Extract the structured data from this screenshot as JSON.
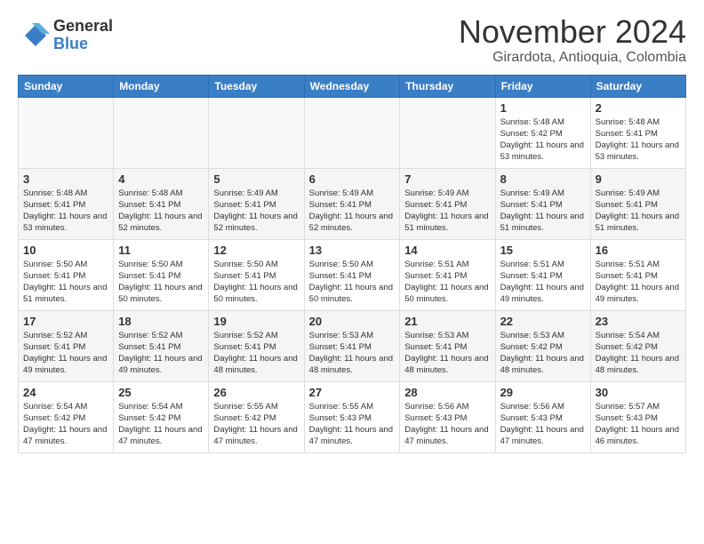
{
  "header": {
    "logo_general": "General",
    "logo_blue": "Blue",
    "month_title": "November 2024",
    "location": "Girardota, Antioquia, Colombia"
  },
  "days_of_week": [
    "Sunday",
    "Monday",
    "Tuesday",
    "Wednesday",
    "Thursday",
    "Friday",
    "Saturday"
  ],
  "weeks": [
    [
      {
        "day": "",
        "sunrise": "",
        "sunset": "",
        "daylight": ""
      },
      {
        "day": "",
        "sunrise": "",
        "sunset": "",
        "daylight": ""
      },
      {
        "day": "",
        "sunrise": "",
        "sunset": "",
        "daylight": ""
      },
      {
        "day": "",
        "sunrise": "",
        "sunset": "",
        "daylight": ""
      },
      {
        "day": "",
        "sunrise": "",
        "sunset": "",
        "daylight": ""
      },
      {
        "day": "1",
        "sunrise": "Sunrise: 5:48 AM",
        "sunset": "Sunset: 5:42 PM",
        "daylight": "Daylight: 11 hours and 53 minutes."
      },
      {
        "day": "2",
        "sunrise": "Sunrise: 5:48 AM",
        "sunset": "Sunset: 5:41 PM",
        "daylight": "Daylight: 11 hours and 53 minutes."
      }
    ],
    [
      {
        "day": "3",
        "sunrise": "Sunrise: 5:48 AM",
        "sunset": "Sunset: 5:41 PM",
        "daylight": "Daylight: 11 hours and 53 minutes."
      },
      {
        "day": "4",
        "sunrise": "Sunrise: 5:48 AM",
        "sunset": "Sunset: 5:41 PM",
        "daylight": "Daylight: 11 hours and 52 minutes."
      },
      {
        "day": "5",
        "sunrise": "Sunrise: 5:49 AM",
        "sunset": "Sunset: 5:41 PM",
        "daylight": "Daylight: 11 hours and 52 minutes."
      },
      {
        "day": "6",
        "sunrise": "Sunrise: 5:49 AM",
        "sunset": "Sunset: 5:41 PM",
        "daylight": "Daylight: 11 hours and 52 minutes."
      },
      {
        "day": "7",
        "sunrise": "Sunrise: 5:49 AM",
        "sunset": "Sunset: 5:41 PM",
        "daylight": "Daylight: 11 hours and 51 minutes."
      },
      {
        "day": "8",
        "sunrise": "Sunrise: 5:49 AM",
        "sunset": "Sunset: 5:41 PM",
        "daylight": "Daylight: 11 hours and 51 minutes."
      },
      {
        "day": "9",
        "sunrise": "Sunrise: 5:49 AM",
        "sunset": "Sunset: 5:41 PM",
        "daylight": "Daylight: 11 hours and 51 minutes."
      }
    ],
    [
      {
        "day": "10",
        "sunrise": "Sunrise: 5:50 AM",
        "sunset": "Sunset: 5:41 PM",
        "daylight": "Daylight: 11 hours and 51 minutes."
      },
      {
        "day": "11",
        "sunrise": "Sunrise: 5:50 AM",
        "sunset": "Sunset: 5:41 PM",
        "daylight": "Daylight: 11 hours and 50 minutes."
      },
      {
        "day": "12",
        "sunrise": "Sunrise: 5:50 AM",
        "sunset": "Sunset: 5:41 PM",
        "daylight": "Daylight: 11 hours and 50 minutes."
      },
      {
        "day": "13",
        "sunrise": "Sunrise: 5:50 AM",
        "sunset": "Sunset: 5:41 PM",
        "daylight": "Daylight: 11 hours and 50 minutes."
      },
      {
        "day": "14",
        "sunrise": "Sunrise: 5:51 AM",
        "sunset": "Sunset: 5:41 PM",
        "daylight": "Daylight: 11 hours and 50 minutes."
      },
      {
        "day": "15",
        "sunrise": "Sunrise: 5:51 AM",
        "sunset": "Sunset: 5:41 PM",
        "daylight": "Daylight: 11 hours and 49 minutes."
      },
      {
        "day": "16",
        "sunrise": "Sunrise: 5:51 AM",
        "sunset": "Sunset: 5:41 PM",
        "daylight": "Daylight: 11 hours and 49 minutes."
      }
    ],
    [
      {
        "day": "17",
        "sunrise": "Sunrise: 5:52 AM",
        "sunset": "Sunset: 5:41 PM",
        "daylight": "Daylight: 11 hours and 49 minutes."
      },
      {
        "day": "18",
        "sunrise": "Sunrise: 5:52 AM",
        "sunset": "Sunset: 5:41 PM",
        "daylight": "Daylight: 11 hours and 49 minutes."
      },
      {
        "day": "19",
        "sunrise": "Sunrise: 5:52 AM",
        "sunset": "Sunset: 5:41 PM",
        "daylight": "Daylight: 11 hours and 48 minutes."
      },
      {
        "day": "20",
        "sunrise": "Sunrise: 5:53 AM",
        "sunset": "Sunset: 5:41 PM",
        "daylight": "Daylight: 11 hours and 48 minutes."
      },
      {
        "day": "21",
        "sunrise": "Sunrise: 5:53 AM",
        "sunset": "Sunset: 5:41 PM",
        "daylight": "Daylight: 11 hours and 48 minutes."
      },
      {
        "day": "22",
        "sunrise": "Sunrise: 5:53 AM",
        "sunset": "Sunset: 5:42 PM",
        "daylight": "Daylight: 11 hours and 48 minutes."
      },
      {
        "day": "23",
        "sunrise": "Sunrise: 5:54 AM",
        "sunset": "Sunset: 5:42 PM",
        "daylight": "Daylight: 11 hours and 48 minutes."
      }
    ],
    [
      {
        "day": "24",
        "sunrise": "Sunrise: 5:54 AM",
        "sunset": "Sunset: 5:42 PM",
        "daylight": "Daylight: 11 hours and 47 minutes."
      },
      {
        "day": "25",
        "sunrise": "Sunrise: 5:54 AM",
        "sunset": "Sunset: 5:42 PM",
        "daylight": "Daylight: 11 hours and 47 minutes."
      },
      {
        "day": "26",
        "sunrise": "Sunrise: 5:55 AM",
        "sunset": "Sunset: 5:42 PM",
        "daylight": "Daylight: 11 hours and 47 minutes."
      },
      {
        "day": "27",
        "sunrise": "Sunrise: 5:55 AM",
        "sunset": "Sunset: 5:43 PM",
        "daylight": "Daylight: 11 hours and 47 minutes."
      },
      {
        "day": "28",
        "sunrise": "Sunrise: 5:56 AM",
        "sunset": "Sunset: 5:43 PM",
        "daylight": "Daylight: 11 hours and 47 minutes."
      },
      {
        "day": "29",
        "sunrise": "Sunrise: 5:56 AM",
        "sunset": "Sunset: 5:43 PM",
        "daylight": "Daylight: 11 hours and 47 minutes."
      },
      {
        "day": "30",
        "sunrise": "Sunrise: 5:57 AM",
        "sunset": "Sunset: 5:43 PM",
        "daylight": "Daylight: 11 hours and 46 minutes."
      }
    ]
  ]
}
